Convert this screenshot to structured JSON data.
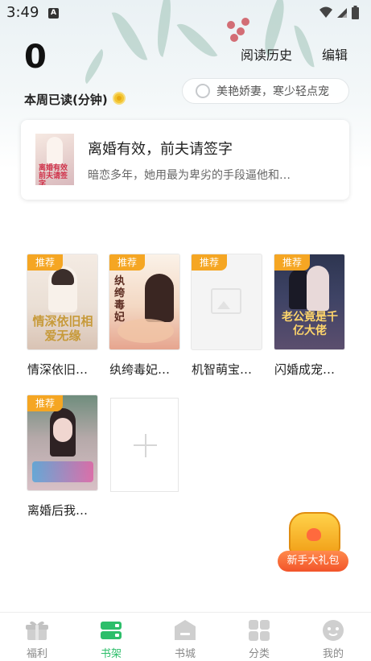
{
  "status_bar": {
    "time": "3:49",
    "notification_badge": "A"
  },
  "header": {
    "weekly_minutes": "0",
    "weekly_label": "本周已读(分钟)",
    "history_label": "阅读历史",
    "edit_label": "编辑"
  },
  "search": {
    "placeholder": "美艳娇妻，寒少轻点宠"
  },
  "recent": {
    "title": "离婚有效，前夫请签字",
    "description": "暗恋多年，她用最为卑劣的手段逼他和…",
    "cover_text": "离婚有效前夫请签字"
  },
  "shelf": {
    "tag": "推荐",
    "books": [
      {
        "title": "情深依旧…",
        "cover_text": "情深依旧相爱无缘"
      },
      {
        "title": "纨绔毒妃…",
        "cover_text": "纨绔毒妃"
      },
      {
        "title": "机智萌宝…",
        "cover_text": ""
      },
      {
        "title": "闪婚成宠…",
        "cover_text": "老公竟是千亿大佬"
      },
      {
        "title": "离婚后我…",
        "cover_text": ""
      }
    ]
  },
  "gift": {
    "label": "新手大礼包"
  },
  "tabs": [
    {
      "label": "福利",
      "icon": "gift-icon",
      "active": false
    },
    {
      "label": "书架",
      "icon": "bookshelf-icon",
      "active": true
    },
    {
      "label": "书城",
      "icon": "bookstore-icon",
      "active": false
    },
    {
      "label": "分类",
      "icon": "category-grid-icon",
      "active": false
    },
    {
      "label": "我的",
      "icon": "profile-face-icon",
      "active": false
    }
  ],
  "colors": {
    "accent_green": "#2dbe6a",
    "tag_orange": "#f5a623",
    "inactive_gray": "#888888"
  }
}
